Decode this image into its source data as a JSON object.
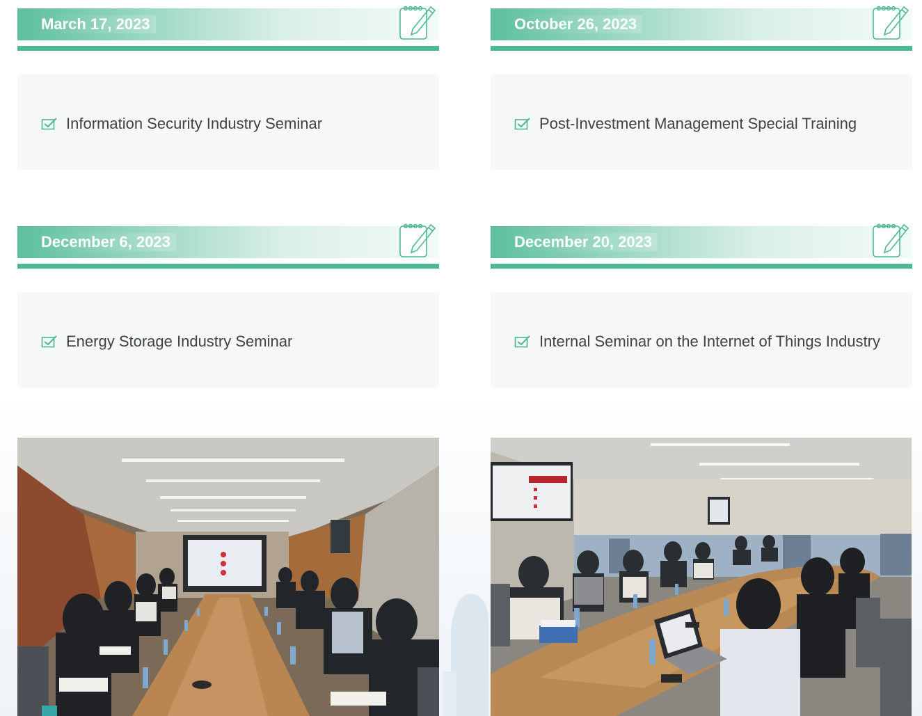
{
  "events": [
    {
      "date": "March 17, 2023",
      "title": "Information Security Industry Seminar"
    },
    {
      "date": "October 26, 2023",
      "title": "Post-Investment Management Special Training"
    },
    {
      "date": "December 6, 2023",
      "title": "Energy Storage Industry Seminar"
    },
    {
      "date": "December 20, 2023",
      "title": "Internal Seminar on the Internet of Things Industry"
    }
  ],
  "icons": {
    "date_icon": "notepad-pen-icon",
    "topic_icon": "checkbox-check-icon"
  },
  "colors": {
    "accent": "#4cb893",
    "date_text": "#ffffff",
    "topic_text": "#3f4346",
    "panel": "#f6f7f7"
  },
  "photos": [
    {
      "name": "meeting-photo-left"
    },
    {
      "name": "meeting-photo-right"
    }
  ]
}
